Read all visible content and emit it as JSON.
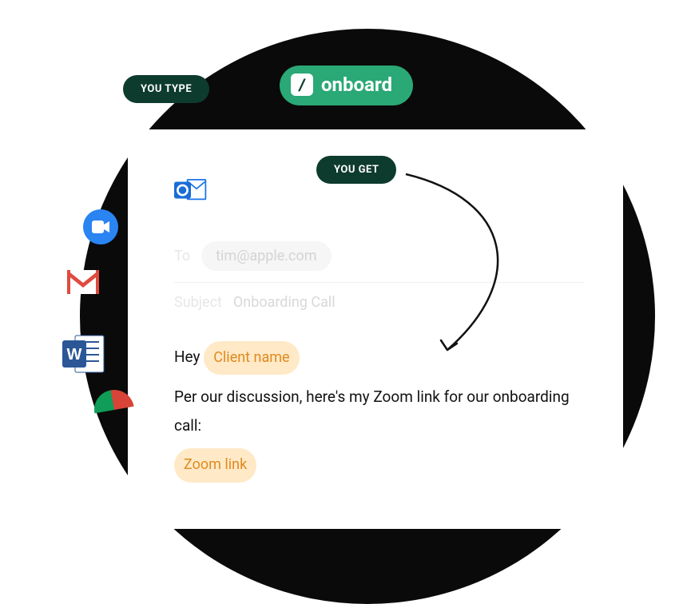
{
  "badges": {
    "you_type": "YOU TYPE",
    "you_get": "YOU GET"
  },
  "onboard_pill": {
    "slash": "/",
    "text": "onboard"
  },
  "compose": {
    "to_label": "To",
    "to_value": "tim@apple.com",
    "subject_label": "Subject",
    "subject_value": "Onboarding Call"
  },
  "body": {
    "hey": "Hey",
    "client_name": "Client name",
    "line2": "Per our discussion, here's my Zoom link for our onboarding call:",
    "zoom_link": "Zoom link"
  },
  "icons": {
    "outlook": "outlook-icon",
    "gcam": "google-camera-icon",
    "gmail": "gmail-icon",
    "word": "word-icon",
    "chrome_fragment": "chrome-icon"
  }
}
